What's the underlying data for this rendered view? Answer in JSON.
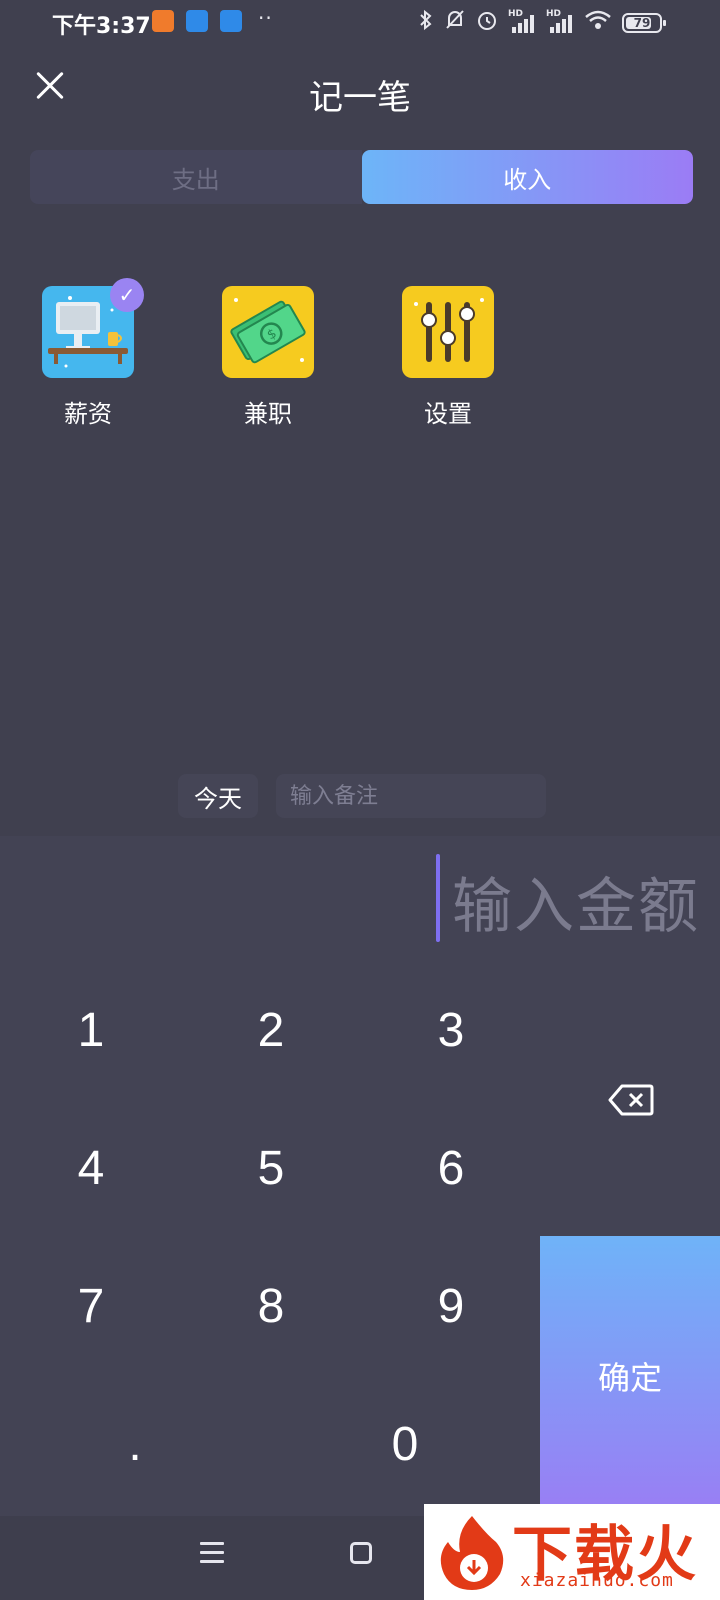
{
  "status_bar": {
    "time": "下午3:37",
    "dots": "··",
    "hd_label": "HD",
    "battery_text": "79",
    "battery_percent": 79,
    "icons": [
      "uc-browser-icon",
      "feishu-icon",
      "feishu-icon",
      "bluetooth-icon",
      "bell-muted-icon",
      "alarm-icon",
      "signal-icon",
      "signal-icon",
      "wifi-icon",
      "battery-icon"
    ]
  },
  "header": {
    "title": "记一笔",
    "close_icon": "close-icon"
  },
  "tabs": [
    {
      "label": "支出",
      "active": false
    },
    {
      "label": "收入",
      "active": true
    }
  ],
  "categories": [
    {
      "label": "薪资",
      "icon": "desk-computer-icon",
      "selected": true
    },
    {
      "label": "兼职",
      "icon": "money-bills-icon",
      "selected": false
    },
    {
      "label": "设置",
      "icon": "sliders-icon",
      "selected": false
    }
  ],
  "note_row": {
    "date_label": "今天",
    "note_placeholder": "输入备注"
  },
  "amount": {
    "placeholder": "输入金额"
  },
  "keypad": {
    "keys": [
      "1",
      "2",
      "3",
      "4",
      "5",
      "6",
      "7",
      "8",
      "9",
      ".",
      "0"
    ],
    "confirm_label": "确定",
    "delete_icon": "backspace-icon"
  },
  "watermark": {
    "text": "下载火",
    "url": "xiazaihuo.com"
  },
  "colors": {
    "background": "#40404f",
    "keypad_background": "#434354",
    "accent_start": "#6db5f8",
    "accent_end": "#9b7cf5",
    "cursor": "#7e6ff0"
  }
}
